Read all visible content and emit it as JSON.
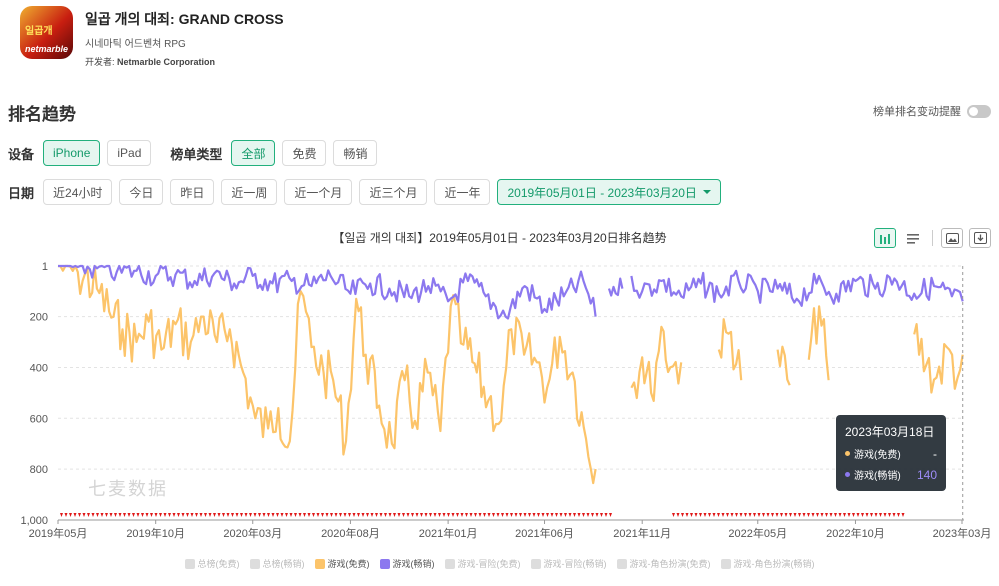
{
  "app": {
    "name": "일곱 개의 대죄: GRAND CROSS",
    "category": "시네마틱 어드벤쳐 RPG",
    "developer_label": "开发者:",
    "developer": "Netmarble Corporation",
    "icon_brand": "netmarble",
    "icon_badge": "일곱개"
  },
  "section": {
    "title": "排名趋势",
    "alert_label": "榜单排名变动提醒"
  },
  "filters": {
    "device_label": "设备",
    "devices": [
      "iPhone",
      "iPad"
    ],
    "device_selected": "iPhone",
    "chart_type_label": "榜单类型",
    "chart_types": [
      "全部",
      "免费",
      "畅销"
    ],
    "chart_type_selected": "全部",
    "date_label": "日期",
    "date_options": [
      "近24小时",
      "今日",
      "昨日",
      "近一周",
      "近一个月",
      "近三个月",
      "近一年"
    ],
    "date_range": "2019年05月01日 - 2023年03月20日"
  },
  "watermark": "七麦数据",
  "colors": {
    "accent": "#22b07d",
    "free_series": "#fcc46a",
    "grossing_series": "#8c78ef",
    "marker": "#e01818",
    "tooltip_bg": "#2b3138"
  },
  "chart_data": {
    "type": "line",
    "title": "【일곱 개의 대죄】2019年05月01日 - 2023年03月20日排名趋势",
    "y_inverted": true,
    "y_ticks": [
      "1",
      "200",
      "400",
      "600",
      "800",
      "1,000"
    ],
    "ylim": [
      1,
      1000
    ],
    "x_ticks": [
      "2019年05月",
      "2019年10月",
      "2020年03月",
      "2020年08月",
      "2021年01月",
      "2021年06月",
      "2021年11月",
      "2022年05月",
      "2022年10月",
      "2023年03月"
    ],
    "xlim": [
      "2019-05-01",
      "2023-03-20"
    ],
    "grid": true,
    "legend_position": "bottom",
    "series": [
      {
        "name": "游戏(免费)",
        "color": "#fcc46a",
        "points": [
          [
            "2019-05-01",
            1
          ],
          [
            "2019-06-01",
            25
          ],
          [
            "2019-07-01",
            90
          ],
          [
            "2019-07-20",
            180
          ],
          [
            "2019-08-10",
            250
          ],
          [
            "2019-09-01",
            300
          ],
          [
            "2019-09-20",
            220
          ],
          [
            "2019-10-10",
            330
          ],
          [
            "2019-11-01",
            230
          ],
          [
            "2019-11-25",
            300
          ],
          [
            "2019-12-15",
            200
          ],
          [
            "2020-01-05",
            300
          ],
          [
            "2020-01-25",
            250
          ],
          [
            "2020-02-15",
            420
          ],
          [
            "2020-03-05",
            600
          ],
          [
            "2020-03-25",
            640
          ],
          [
            "2020-04-10",
            560
          ],
          [
            "2020-04-28",
            690
          ],
          [
            "2020-05-15",
            100
          ],
          [
            "2020-06-01",
            320
          ],
          [
            "2020-06-20",
            420
          ],
          [
            "2020-07-05",
            450
          ],
          [
            "2020-07-25",
            690
          ],
          [
            "2020-08-10",
            130
          ],
          [
            "2020-08-25",
            350
          ],
          [
            "2020-09-15",
            550
          ],
          [
            "2020-10-05",
            700
          ],
          [
            "2020-10-25",
            450
          ],
          [
            "2020-11-10",
            610
          ],
          [
            "2020-11-30",
            420
          ],
          [
            "2020-12-20",
            650
          ],
          [
            "2021-01-05",
            160
          ],
          [
            "2021-01-25",
            310
          ],
          [
            "2021-02-15",
            420
          ],
          [
            "2021-03-05",
            530
          ],
          [
            "2021-03-25",
            610
          ],
          [
            "2021-04-10",
            250
          ],
          [
            "2021-04-30",
            350
          ],
          [
            "2021-05-20",
            380
          ],
          [
            "2021-06-05",
            480
          ],
          [
            "2021-06-25",
            280
          ],
          [
            "2021-07-15",
            420
          ],
          [
            "2021-08-05",
            680
          ],
          [
            "2021-08-20",
            800
          ],
          [
            null,
            null
          ],
          [
            "2021-10-15",
            480
          ],
          [
            "2021-11-01",
            360
          ],
          [
            "2021-11-15",
            500
          ],
          [
            "2021-12-01",
            240
          ],
          [
            "2021-12-15",
            400
          ],
          [
            "2022-01-01",
            380
          ],
          [
            null,
            null
          ],
          [
            "2022-03-01",
            330
          ],
          [
            "2022-03-20",
            260
          ],
          [
            "2022-04-05",
            450
          ],
          [
            null,
            null
          ],
          [
            "2022-06-01",
            330
          ],
          [
            "2022-06-20",
            470
          ],
          [
            null,
            null
          ],
          [
            "2022-07-20",
            370
          ],
          [
            "2022-08-05",
            160
          ],
          [
            "2022-08-20",
            450
          ],
          [
            null,
            null
          ],
          [
            "2022-10-01",
            360
          ],
          [
            null,
            null
          ],
          [
            "2023-01-01",
            270
          ],
          [
            "2023-01-20",
            390
          ],
          [
            "2023-02-05",
            440
          ],
          [
            "2023-02-25",
            330
          ],
          [
            "2023-03-10",
            440
          ],
          [
            "2023-03-18",
            350
          ]
        ]
      },
      {
        "name": "游戏(畅销)",
        "color": "#8c78ef",
        "points": [
          [
            "2019-05-01",
            1
          ],
          [
            "2019-06-01",
            5
          ],
          [
            "2019-07-01",
            10
          ],
          [
            "2019-08-01",
            25
          ],
          [
            "2019-09-01",
            20
          ],
          [
            "2019-10-01",
            40
          ],
          [
            "2019-11-01",
            35
          ],
          [
            "2019-12-01",
            60
          ],
          [
            "2020-01-01",
            30
          ],
          [
            "2020-02-01",
            70
          ],
          [
            "2020-03-01",
            40
          ],
          [
            "2020-04-01",
            70
          ],
          [
            "2020-05-01",
            60
          ],
          [
            "2020-06-01",
            80
          ],
          [
            "2020-07-01",
            40
          ],
          [
            "2020-08-01",
            110
          ],
          [
            "2020-09-01",
            70
          ],
          [
            "2020-10-01",
            90
          ],
          [
            "2020-11-01",
            120
          ],
          [
            "2020-12-01",
            80
          ],
          [
            "2021-01-01",
            140
          ],
          [
            "2021-02-01",
            60
          ],
          [
            "2021-03-01",
            120
          ],
          [
            "2021-04-01",
            200
          ],
          [
            "2021-05-01",
            80
          ],
          [
            "2021-06-01",
            170
          ],
          [
            "2021-07-01",
            120
          ],
          [
            "2021-08-01",
            60
          ],
          [
            "2021-08-20",
            200
          ],
          [
            null,
            null
          ],
          [
            "2021-09-10",
            90
          ],
          [
            "2021-10-01",
            90
          ],
          [
            null,
            null
          ],
          [
            "2021-10-15",
            40
          ],
          [
            "2021-11-01",
            100
          ],
          [
            "2021-12-01",
            60
          ],
          [
            "2022-01-01",
            120
          ],
          [
            "2022-02-01",
            70
          ],
          [
            "2022-03-01",
            110
          ],
          [
            "2022-04-01",
            60
          ],
          [
            "2022-05-01",
            100
          ],
          [
            "2022-06-01",
            90
          ],
          [
            "2022-07-01",
            130
          ],
          [
            "2022-08-01",
            70
          ],
          [
            "2022-09-01",
            110
          ],
          [
            "2022-10-01",
            60
          ],
          [
            "2022-11-01",
            90
          ],
          [
            "2022-12-01",
            50
          ],
          [
            "2023-01-01",
            110
          ],
          [
            "2023-02-01",
            80
          ],
          [
            "2023-03-01",
            120
          ],
          [
            "2023-03-18",
            140
          ]
        ]
      }
    ]
  },
  "tooltip": {
    "date": "2023年03月18日",
    "rows": [
      {
        "name": "游戏(免费)",
        "value": "-",
        "color": "#fcc46a"
      },
      {
        "name": "游戏(畅销)",
        "value": "140",
        "color": "#8c78ef"
      }
    ]
  },
  "legend": [
    {
      "label": "总榜(免费)",
      "active": false
    },
    {
      "label": "总榜(畅销)",
      "active": false
    },
    {
      "label": "游戏(免费)",
      "active": true,
      "color": "#fcc46a"
    },
    {
      "label": "游戏(畅销)",
      "active": true,
      "color": "#8c78ef"
    },
    {
      "label": "游戏-冒险(免费)",
      "active": false
    },
    {
      "label": "游戏-冒险(畅销)",
      "active": false
    },
    {
      "label": "游戏-角色扮演(免费)",
      "active": false
    },
    {
      "label": "游戏-角色扮演(畅销)",
      "active": false
    }
  ]
}
